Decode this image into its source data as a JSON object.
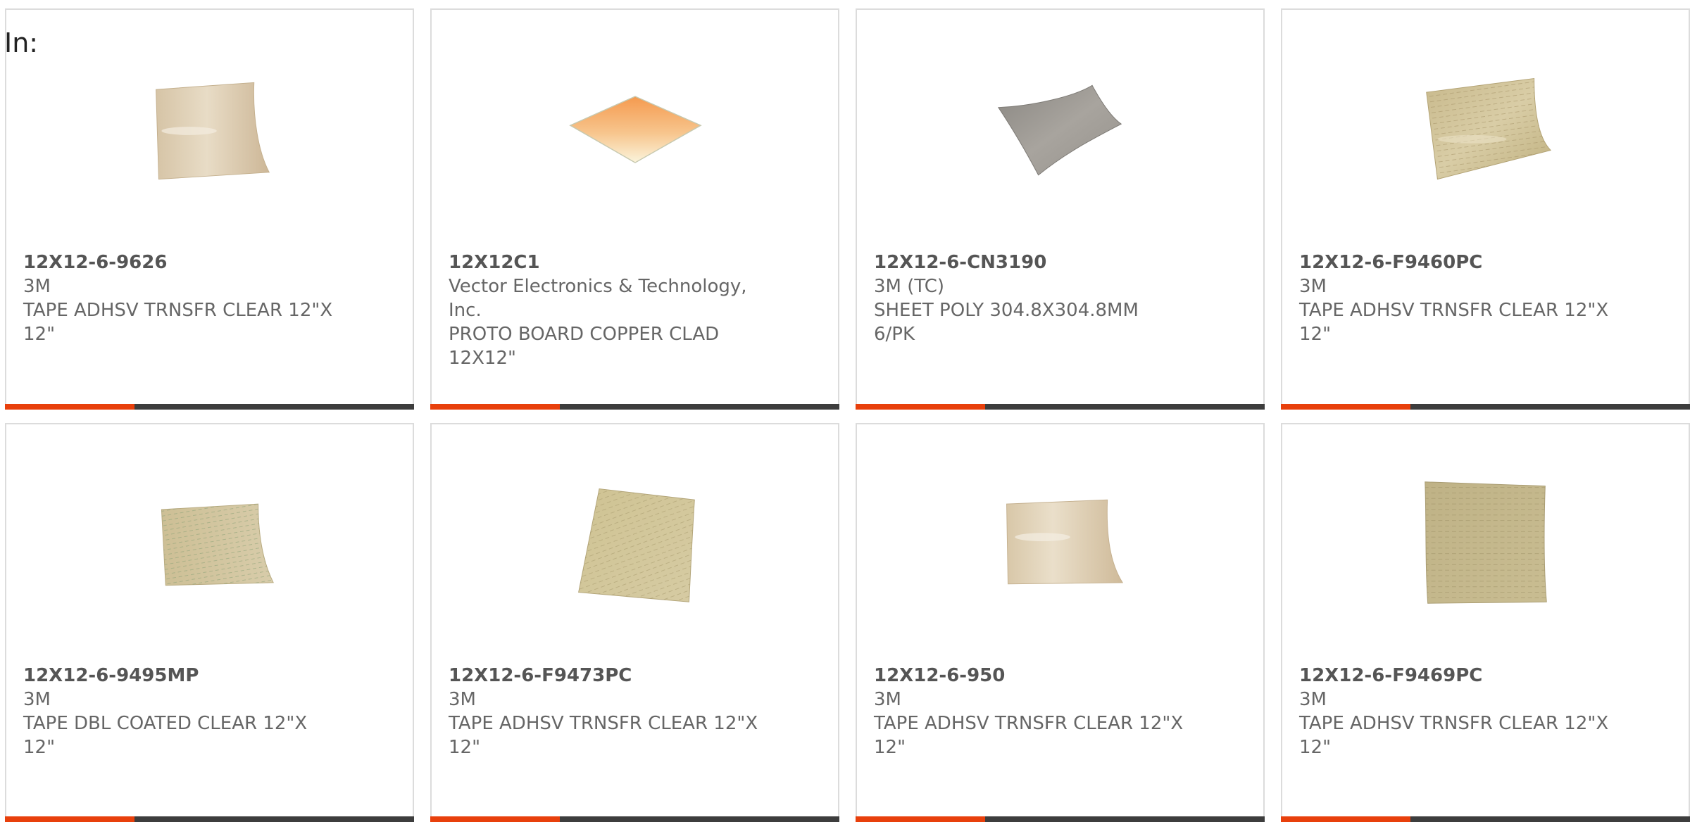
{
  "heading": "In:",
  "colors": {
    "accent": "#e8400c",
    "bar": "#3d3d3d",
    "border": "#dcdcdc",
    "text": "#666666"
  },
  "products": [
    {
      "part": "12X12-6-9626",
      "manufacturer": "3M",
      "description": "TAPE ADHSV TRNSFR CLEAR 12\"X 12\"",
      "image": "tan-transfer-tape-sheet"
    },
    {
      "part": "12X12C1",
      "manufacturer": "Vector Electronics & Technology, Inc.",
      "description": "PROTO BOARD COPPER CLAD 12X12\"",
      "image": "copper-clad-board"
    },
    {
      "part": "12X12-6-CN3190",
      "manufacturer": "3M (TC)",
      "description": "SHEET POLY 304.8X304.8MM 6/PK",
      "image": "gray-poly-sheet"
    },
    {
      "part": "12X12-6-F9460PC",
      "manufacturer": "3M",
      "description": "TAPE ADHSV TRNSFR CLEAR 12\"X 12\"",
      "image": "printed-transfer-tape-sheet"
    },
    {
      "part": "12X12-6-9495MP",
      "manufacturer": "3M",
      "description": "TAPE DBL COATED CLEAR 12\"X 12\"",
      "image": "printed-double-coated-tape-sheet"
    },
    {
      "part": "12X12-6-F9473PC",
      "manufacturer": "3M",
      "description": "TAPE ADHSV TRNSFR CLEAR 12\"X 12\"",
      "image": "printed-transfer-tape-sheet"
    },
    {
      "part": "12X12-6-950",
      "manufacturer": "3M",
      "description": "TAPE ADHSV TRNSFR CLEAR 12\"X 12\"",
      "image": "tan-transfer-tape-sheet"
    },
    {
      "part": "12X12-6-F9469PC",
      "manufacturer": "3M",
      "description": "TAPE ADHSV TRNSFR CLEAR 12\"X 12\"",
      "image": "printed-transfer-tape-sheet"
    }
  ]
}
